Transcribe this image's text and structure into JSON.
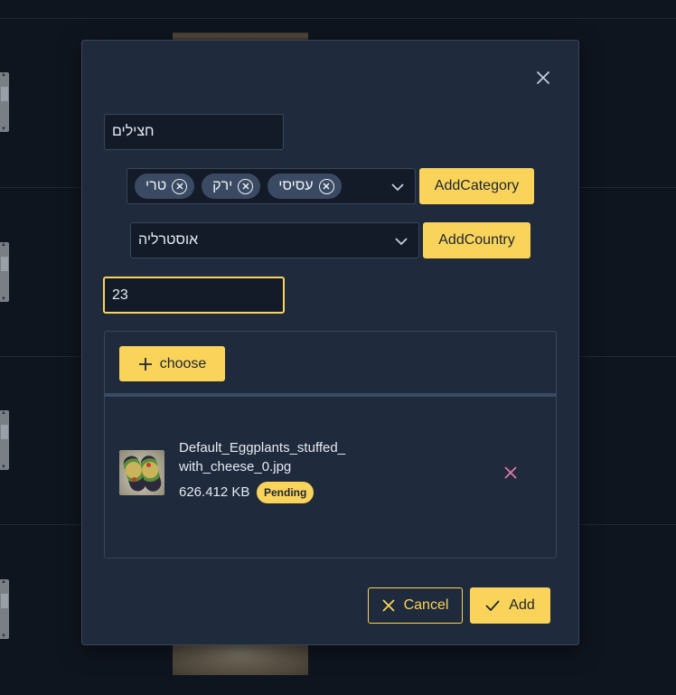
{
  "dialog": {
    "name_value": "חצילים",
    "categories": {
      "chips": [
        {
          "label": "טרי"
        },
        {
          "label": "ירק"
        },
        {
          "label": "עסיסי"
        }
      ],
      "add_label": "AddCategory"
    },
    "country": {
      "value": "אוסטרליה",
      "add_label": "AddCountry"
    },
    "number_value": "23",
    "upload": {
      "choose_label": "choose",
      "file": {
        "name": "Default_Eggplants_stuffed_with_cheese_0.jpg",
        "size": "626.412 KB",
        "status": "Pending"
      }
    },
    "cancel_label": "Cancel",
    "add_label": "Add"
  },
  "colors": {
    "accent": "#fad45a",
    "dialog_bg": "#1f2a3c",
    "field_bg": "#131b29",
    "remove": "#e07aa0"
  },
  "icons": [
    "close-icon",
    "circle-x-icon",
    "chevron-down-icon",
    "plus-icon",
    "times-icon",
    "check-icon"
  ]
}
